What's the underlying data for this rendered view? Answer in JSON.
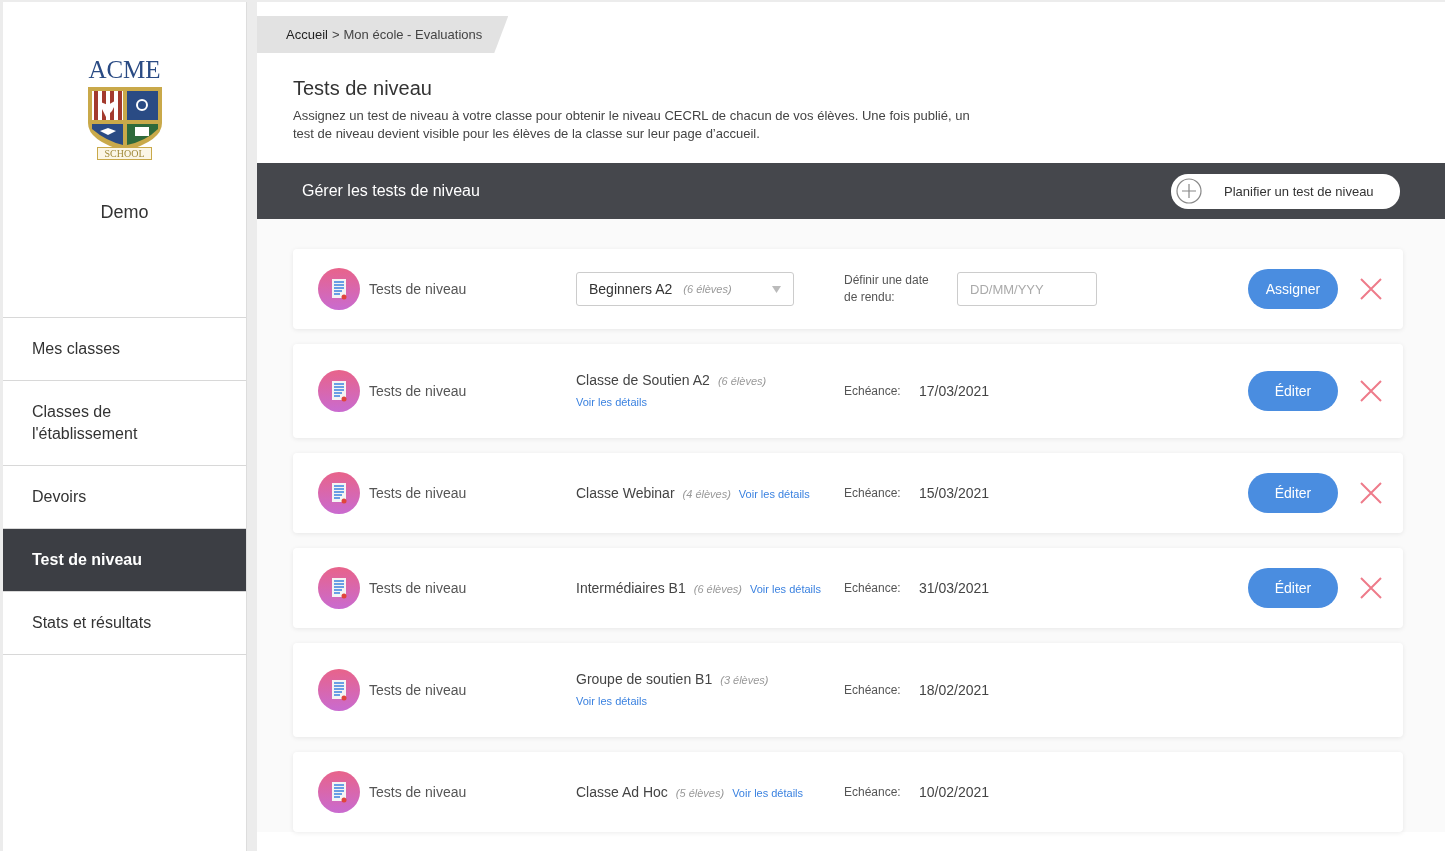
{
  "sidebar": {
    "logo": {
      "title": "ACME",
      "banner": "SCHOOL"
    },
    "school_name": "Demo",
    "items": [
      {
        "label": "Mes classes",
        "selected": false
      },
      {
        "label": "Classes de l'établissement",
        "selected": false
      },
      {
        "label": "Devoirs",
        "selected": false
      },
      {
        "label": "Test de niveau",
        "selected": true
      },
      {
        "label": "Stats et résultats",
        "selected": false
      }
    ]
  },
  "breadcrumb": {
    "items": [
      "Accueil",
      "Mon école - Evaluations"
    ],
    "separator": ">"
  },
  "page": {
    "title": "Tests de niveau",
    "description": "Assignez un test de niveau à votre classe pour obtenir le niveau CECRL de chacun de vos élèves. Une fois publié, un test de niveau devient visible pour les élèves de la classe sur leur page d’accueil."
  },
  "toolbar": {
    "title": "Gérer les tests de niveau",
    "button": "Planifier un test de niveau"
  },
  "rows": [
    {
      "kind": "new",
      "label": "Tests de niveau",
      "class_name": "Beginners A2",
      "count": "(6 élèves)",
      "due_label": "Définir une date de rendu:",
      "date_placeholder": "DD/MM/YYY",
      "button": "Assigner",
      "deletable": true
    },
    {
      "kind": "assigned",
      "label": "Tests de niveau",
      "class_name": "Classe de Soutien A2",
      "count": "(6 élèves)",
      "link": "Voir les détails",
      "due_label": "Echéance:",
      "due": "17/03/2021",
      "button": "Éditer",
      "deletable": true
    },
    {
      "kind": "assigned",
      "label": "Tests de niveau",
      "class_name": "Classe Webinar",
      "count": "(4 élèves)",
      "link": "Voir les détails",
      "due_label": "Echéance:",
      "due": "15/03/2021",
      "button": "Éditer",
      "deletable": true
    },
    {
      "kind": "assigned",
      "label": "Tests de niveau",
      "class_name": "Intermédiaires B1",
      "count": "(6 élèves)",
      "link": "Voir les détails",
      "due_label": "Echéance:",
      "due": "31/03/2021",
      "button": "Éditer",
      "deletable": true
    },
    {
      "kind": "assigned",
      "label": "Tests de niveau",
      "class_name": "Groupe de soutien B1",
      "count": "(3 élèves)",
      "link": "Voir les détails",
      "due_label": "Echéance:",
      "due": "18/02/2021",
      "deletable": false
    },
    {
      "kind": "assigned",
      "label": "Tests de niveau",
      "class_name": "Classe Ad Hoc",
      "count": "(5 élèves)",
      "link": "Voir les détails",
      "due_label": "Echéance:",
      "due": "10/02/2021",
      "deletable": false
    }
  ]
}
